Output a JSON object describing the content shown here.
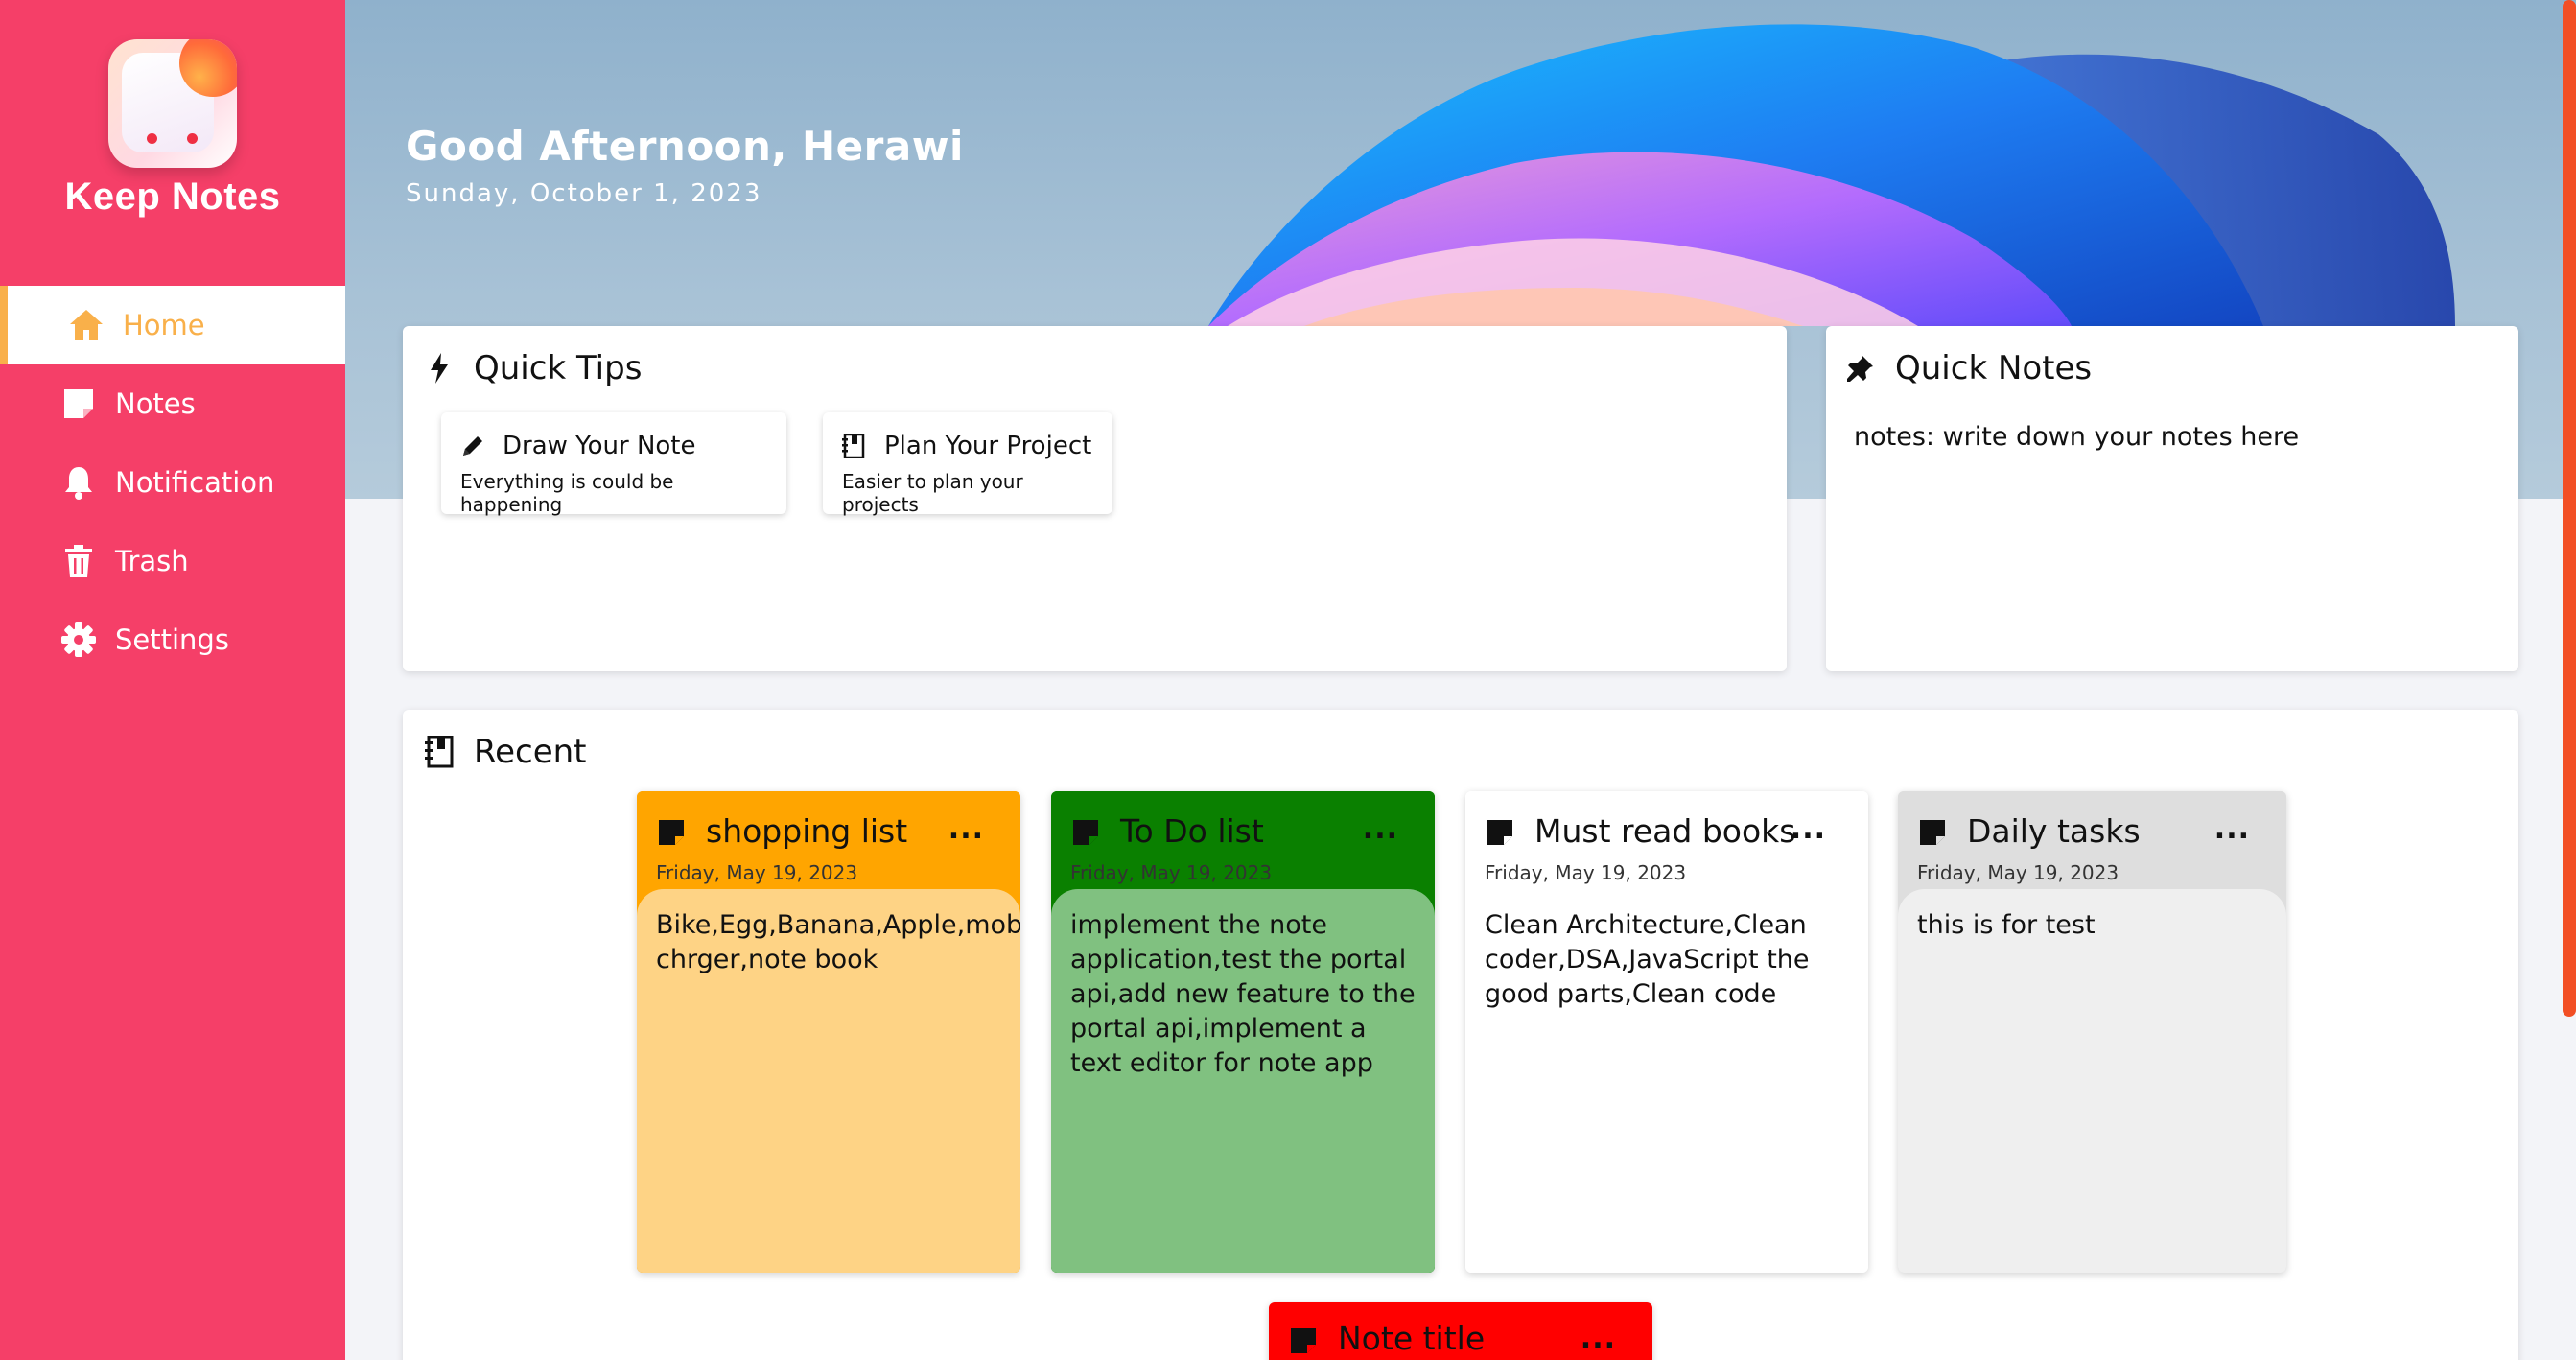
{
  "sidebar": {
    "app_name": "Keep Notes",
    "items": [
      {
        "label": "Home",
        "icon": "home-icon",
        "active": true
      },
      {
        "label": "Notes",
        "icon": "note-icon",
        "active": false
      },
      {
        "label": "Notification",
        "icon": "bell-icon",
        "active": false
      },
      {
        "label": "Trash",
        "icon": "trash-icon",
        "active": false
      },
      {
        "label": "Settings",
        "icon": "gear-icon",
        "active": false
      }
    ],
    "colors": {
      "background": "#f53f68",
      "active_accent": "#f9b04a"
    }
  },
  "header": {
    "greeting": "Good Afternoon, Herawi",
    "date": "Sunday, October 1, 2023"
  },
  "quick_tips": {
    "title": "Quick Tips",
    "tips": [
      {
        "title": "Draw Your Note",
        "subtitle": "Everything is could be happening",
        "icon": "pencil-icon"
      },
      {
        "title": "Plan Your Project",
        "subtitle": "Easier to plan your projects",
        "icon": "notebook-icon"
      }
    ]
  },
  "quick_notes": {
    "title": "Quick Notes",
    "text": "notes: write down your notes here"
  },
  "recent": {
    "title": "Recent",
    "notes": [
      {
        "title": "shopping list",
        "date": "Friday, May 19, 2023",
        "body": "Bike,Egg,Banana,Apple,mobile chrger,note book",
        "header_color": "#ffa500",
        "body_color": "#fed385",
        "more": "..."
      },
      {
        "title": "To Do list",
        "date": "Friday, May 19, 2023",
        "body": "implement the note application,test the portal api,add new feature to the portal api,implement a text editor for note app",
        "header_color": "#0a8000",
        "body_color": "#80c180",
        "more": "..."
      },
      {
        "title": "Must read books",
        "date": "Friday, May 19, 2023",
        "body": "Clean Architecture,Clean coder,DSA,JavaScript the good parts,Clean code",
        "header_color": "#ffffff",
        "body_color": "#ffffff",
        "more": "..."
      },
      {
        "title": "Daily tasks",
        "date": "Friday, May 19, 2023",
        "body": "this is for test",
        "header_color": "#dedede",
        "body_color": "#efefef",
        "more": "..."
      }
    ],
    "partial_note": {
      "title": "Note title",
      "more": "...",
      "color": "#ff0000"
    }
  },
  "scrollbar_color": "#f24f25"
}
